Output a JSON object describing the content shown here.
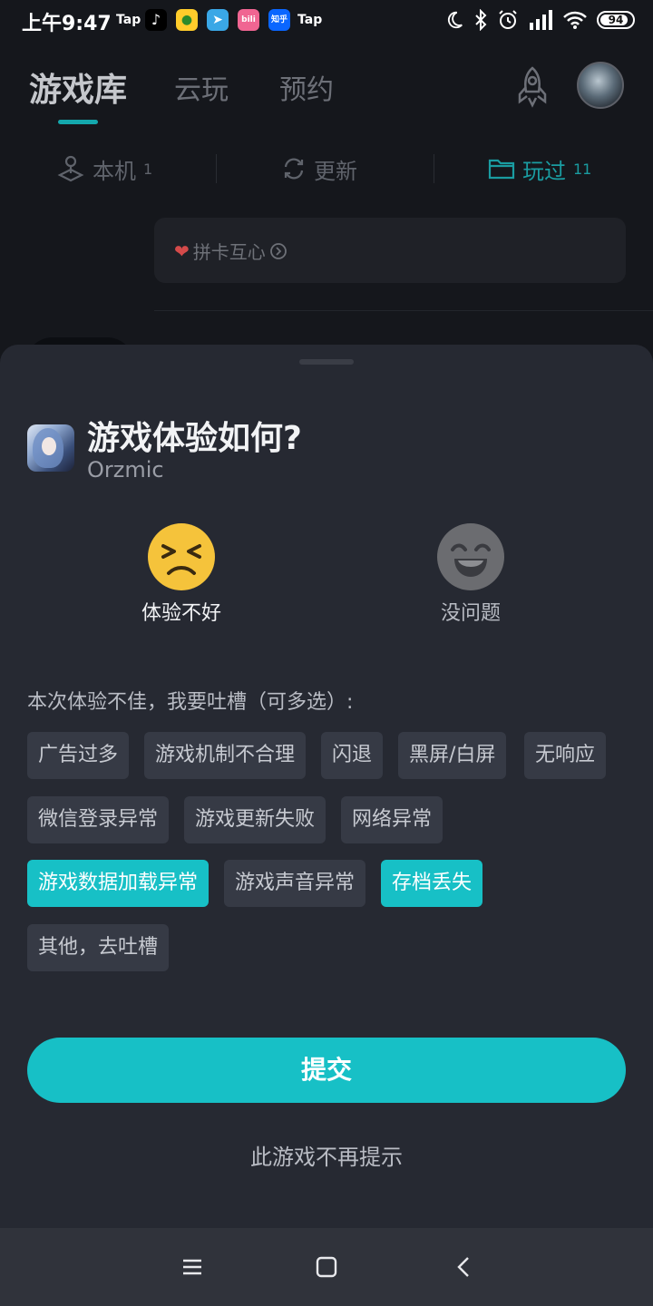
{
  "status_bar": {
    "time": "上午9:47",
    "apps": [
      "Tap",
      "douyin-icon",
      "melon-icon",
      "telegram-icon",
      "bilibili-icon",
      "知乎",
      "Tap"
    ],
    "tap_label": "Tap",
    "zhihu_label": "知乎",
    "battery": "94"
  },
  "top_nav": {
    "tabs": [
      "游戏库",
      "云玩",
      "预约"
    ],
    "active_tab": "游戏库"
  },
  "filters": [
    {
      "label": "本机",
      "count": "1"
    },
    {
      "label": "更新",
      "count": ""
    },
    {
      "label": "玩过",
      "count": "11"
    }
  ],
  "banner": {
    "text": "拼卡互心"
  },
  "sheet": {
    "title": "游戏体验如何?",
    "game_name": "Orzmic",
    "options": [
      {
        "label": "体验不好",
        "selected": true
      },
      {
        "label": "没问题",
        "selected": false
      }
    ],
    "complain_prompt": "本次体验不佳，我要吐槽（可多选）:",
    "tags": [
      {
        "label": "广告过多",
        "selected": false
      },
      {
        "label": "游戏机制不合理",
        "selected": false
      },
      {
        "label": "闪退",
        "selected": false
      },
      {
        "label": "黑屏/白屏",
        "selected": false
      },
      {
        "label": "无响应",
        "selected": false
      },
      {
        "label": "微信登录异常",
        "selected": false
      },
      {
        "label": "游戏更新失败",
        "selected": false
      },
      {
        "label": "网络异常",
        "selected": false
      },
      {
        "label": "游戏数据加载异常",
        "selected": true
      },
      {
        "label": "游戏声音异常",
        "selected": false
      },
      {
        "label": "存档丢失",
        "selected": true
      },
      {
        "label": "其他，去吐槽",
        "selected": false
      }
    ],
    "submit_label": "提交",
    "no_remind_label": "此游戏不再提示"
  },
  "colors": {
    "accent": "#17c0c6",
    "sheet_bg": "#262932",
    "tag_bg": "#363a45"
  }
}
